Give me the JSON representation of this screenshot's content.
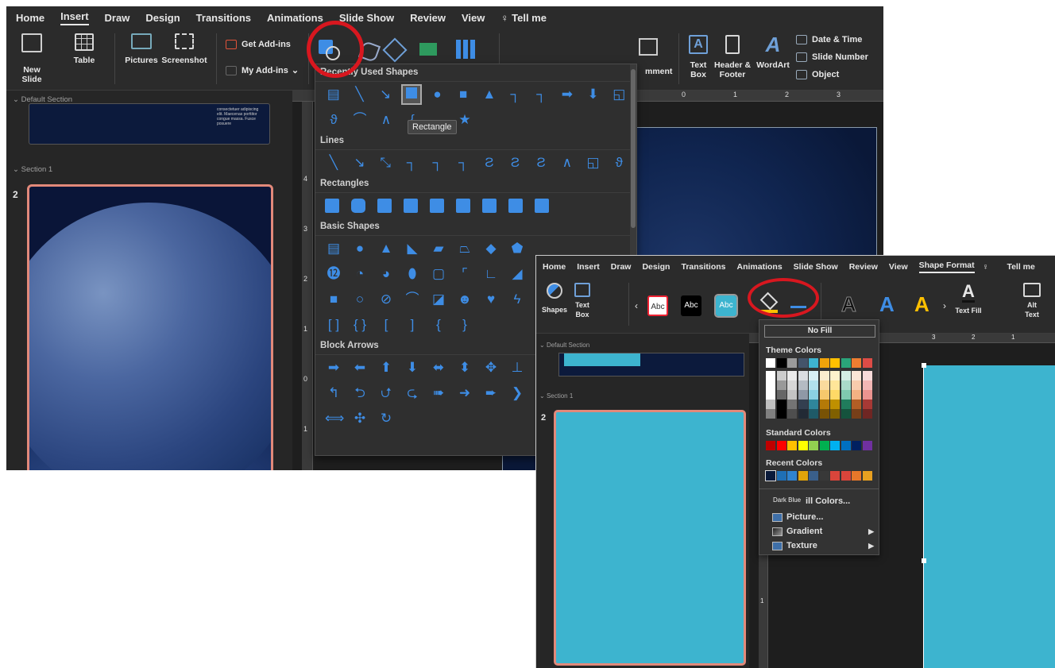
{
  "shot1": {
    "tabs": [
      "Home",
      "Insert",
      "Draw",
      "Design",
      "Transitions",
      "Animations",
      "Slide Show",
      "Review",
      "View",
      "Tell me"
    ],
    "active_tab": "Insert",
    "ribbon": {
      "new_slide": "New Slide",
      "table": "Table",
      "pictures": "Pictures",
      "screenshot": "Screenshot",
      "get_addins": "Get Add-ins",
      "my_addins": "My Add-ins",
      "comment": "mment",
      "text_box": "Text Box",
      "header_footer": "Header & Footer",
      "wordart": "WordArt",
      "date_time": "Date & Time",
      "slide_number": "Slide Number",
      "object": "Object"
    },
    "panel": {
      "default_section": "Default Section",
      "section1": "Section 1",
      "slide_num": "2",
      "thumb_text": "consectetuer adipiscing elit. Maecenas porttitor congue massa. Fusce posuere"
    },
    "shapes_menu": {
      "recently_used": "Recently Used Shapes",
      "lines": "Lines",
      "rectangles": "Rectangles",
      "basic": "Basic Shapes",
      "block_arrows": "Block Arrows",
      "tooltip": "Rectangle"
    },
    "ruler": {
      "h_ticks": [
        "0",
        "1",
        "2",
        "3"
      ],
      "v_ticks": [
        "4",
        "3",
        "2",
        "1",
        "0",
        "1",
        "2"
      ]
    }
  },
  "shot2": {
    "tabs": [
      "Home",
      "Insert",
      "Draw",
      "Design",
      "Transitions",
      "Animations",
      "Slide Show",
      "Review",
      "View",
      "Shape Format",
      "Tell me"
    ],
    "active_tab": "Shape Format",
    "ribbon": {
      "shapes": "Shapes",
      "text_box": "Text Box",
      "abc": "Abc",
      "text_fill": "Text Fill",
      "alt_text": "Alt Text",
      "wordart_letter": "A",
      "left_arrow": "‹",
      "right_arrow": "›"
    },
    "panel": {
      "default_section": "Default Section",
      "section1": "Section 1",
      "slide_num": "2"
    },
    "ruler": {
      "h_ticks": [
        "3",
        "2",
        "1"
      ],
      "v_ticks": [
        "0",
        "1"
      ]
    },
    "fill_menu": {
      "no_fill": "No Fill",
      "theme_colors": "Theme Colors",
      "standard_colors": "Standard Colors",
      "recent_colors": "Recent Colors",
      "more_fill_colors": "ill Colors...",
      "tooltip": "Dark Blue",
      "picture": "Picture...",
      "gradient": "Gradient",
      "texture": "Texture",
      "theme_top": [
        "#ffffff",
        "#000000",
        "#9b9b9b",
        "#44546a",
        "#3eb3cf",
        "#f0a30a",
        "#ffc000",
        "#2aa57a",
        "#ed7d31",
        "#de4c46"
      ],
      "standard": [
        "#c00000",
        "#ff0000",
        "#ffc000",
        "#ffff00",
        "#92d050",
        "#00b050",
        "#00b0f0",
        "#0070c0",
        "#002060",
        "#7030a0"
      ],
      "recent": [
        "#0a1a3a",
        "#1f6fb5",
        "#2f83cf",
        "#e0a30a",
        "#3a5f8a",
        "#383838",
        "#d9453b",
        "#d9453b",
        "#e8772a",
        "#e8a020"
      ]
    }
  },
  "colors": {
    "accent_red": "#d8171f",
    "shape_blue": "#3e8de5",
    "slide_teal": "#3db4cf",
    "thumb_border": "#e2897a"
  }
}
